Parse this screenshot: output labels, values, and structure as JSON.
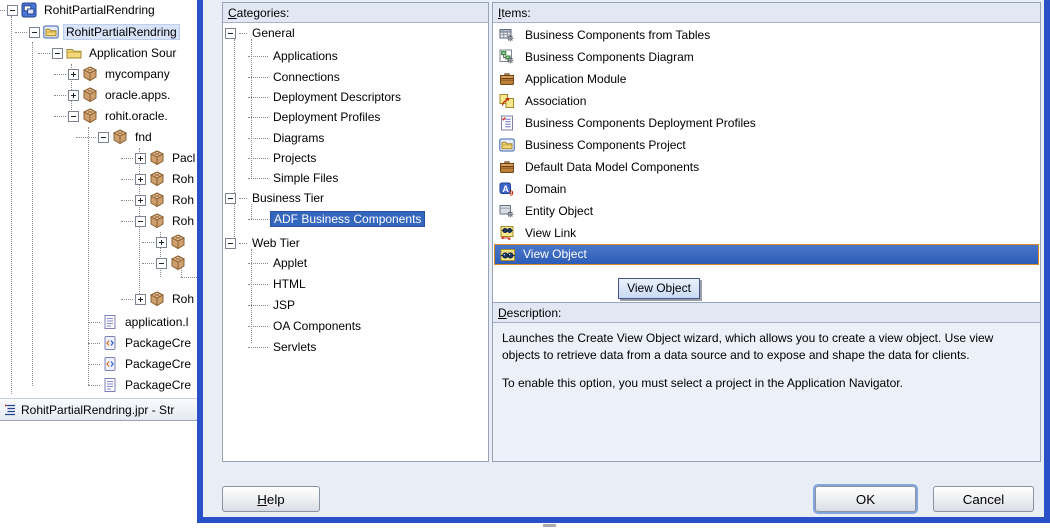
{
  "navigator": {
    "tree": [
      {
        "label": "RohitPartialRendring",
        "icon": "workspace",
        "expand": "minus"
      },
      {
        "label": "RohitPartialRendring",
        "icon": "project-folder",
        "expand": "minus",
        "selected": true
      },
      {
        "label": "Application Sour",
        "icon": "folder",
        "expand": "minus"
      },
      {
        "label": "mycompany",
        "icon": "package",
        "expand": "plus"
      },
      {
        "label": "oracle.apps.",
        "icon": "package",
        "expand": "plus"
      },
      {
        "label": "rohit.oracle.",
        "icon": "package",
        "expand": "minus"
      },
      {
        "label": "fnd",
        "icon": "package",
        "expand": "minus"
      },
      {
        "label": "Pacl",
        "icon": "package",
        "expand": "plus"
      },
      {
        "label": "Roh",
        "icon": "package",
        "expand": "plus"
      },
      {
        "label": "Roh",
        "icon": "package",
        "expand": "plus"
      },
      {
        "label": "Roh",
        "icon": "package",
        "expand": "minus"
      },
      {
        "label": "",
        "icon": "package",
        "expand": "plus"
      },
      {
        "label": "",
        "icon": "package",
        "expand": "minus"
      },
      {
        "label": "Roh",
        "icon": "package",
        "expand": "plus"
      },
      {
        "label": "application.l",
        "icon": "document"
      },
      {
        "label": "PackageCre",
        "icon": "xml-file"
      },
      {
        "label": "PackageCre",
        "icon": "xml-file"
      },
      {
        "label": "PackageCre",
        "icon": "document"
      }
    ],
    "structure_bar": {
      "label": "RohitPartialRendring.jpr - Str",
      "icon": "structure"
    }
  },
  "dialog": {
    "categories": {
      "header": "Categories:",
      "tree": [
        {
          "label": "General",
          "parent": true,
          "expand": "minus"
        },
        {
          "label": "Applications"
        },
        {
          "label": "Connections"
        },
        {
          "label": "Deployment Descriptors"
        },
        {
          "label": "Deployment Profiles"
        },
        {
          "label": "Diagrams"
        },
        {
          "label": "Projects"
        },
        {
          "label": "Simple Files"
        },
        {
          "label": "Business Tier",
          "parent": true,
          "expand": "minus"
        },
        {
          "label": "ADF Business Components",
          "selected": true
        },
        {
          "label": "Web Tier",
          "parent": true,
          "expand": "minus"
        },
        {
          "label": "Applet"
        },
        {
          "label": "HTML"
        },
        {
          "label": "JSP"
        },
        {
          "label": "OA Components"
        },
        {
          "label": "Servlets"
        }
      ]
    },
    "items": {
      "header": "Items:",
      "list": [
        {
          "label": "Business Components from Tables",
          "icon": "bc-from-tables"
        },
        {
          "label": "Business Components Diagram",
          "icon": "bc-diagram"
        },
        {
          "label": "Application Module",
          "icon": "application-module"
        },
        {
          "label": "Association",
          "icon": "association"
        },
        {
          "label": "Business Components Deployment Profiles",
          "icon": "bc-deployment-profiles"
        },
        {
          "label": "Business Components Project",
          "icon": "bc-project"
        },
        {
          "label": "Default Data Model Components",
          "icon": "default-data-model"
        },
        {
          "label": "Domain",
          "icon": "domain"
        },
        {
          "label": "Entity Object",
          "icon": "entity-object"
        },
        {
          "label": "View Link",
          "icon": "view-link"
        },
        {
          "label": "View Object",
          "icon": "view-object",
          "selected": true
        }
      ]
    },
    "tooltip": {
      "label": "View Object"
    },
    "description": {
      "header": "Description:",
      "para1": "Launches the Create View Object wizard, which allows you to create a view object. Use view objects to retrieve data from a data source and to expose and shape the data for clients.",
      "para2": "To enable this option, you must select a project in the Application Navigator."
    },
    "buttons": {
      "help": "Help",
      "ok": "OK",
      "cancel": "Cancel"
    }
  },
  "colors": {
    "selection_blue": "#3566bd",
    "selection_border_orange": "#d78a2e",
    "window_frame_blue": "#2a50c8"
  }
}
